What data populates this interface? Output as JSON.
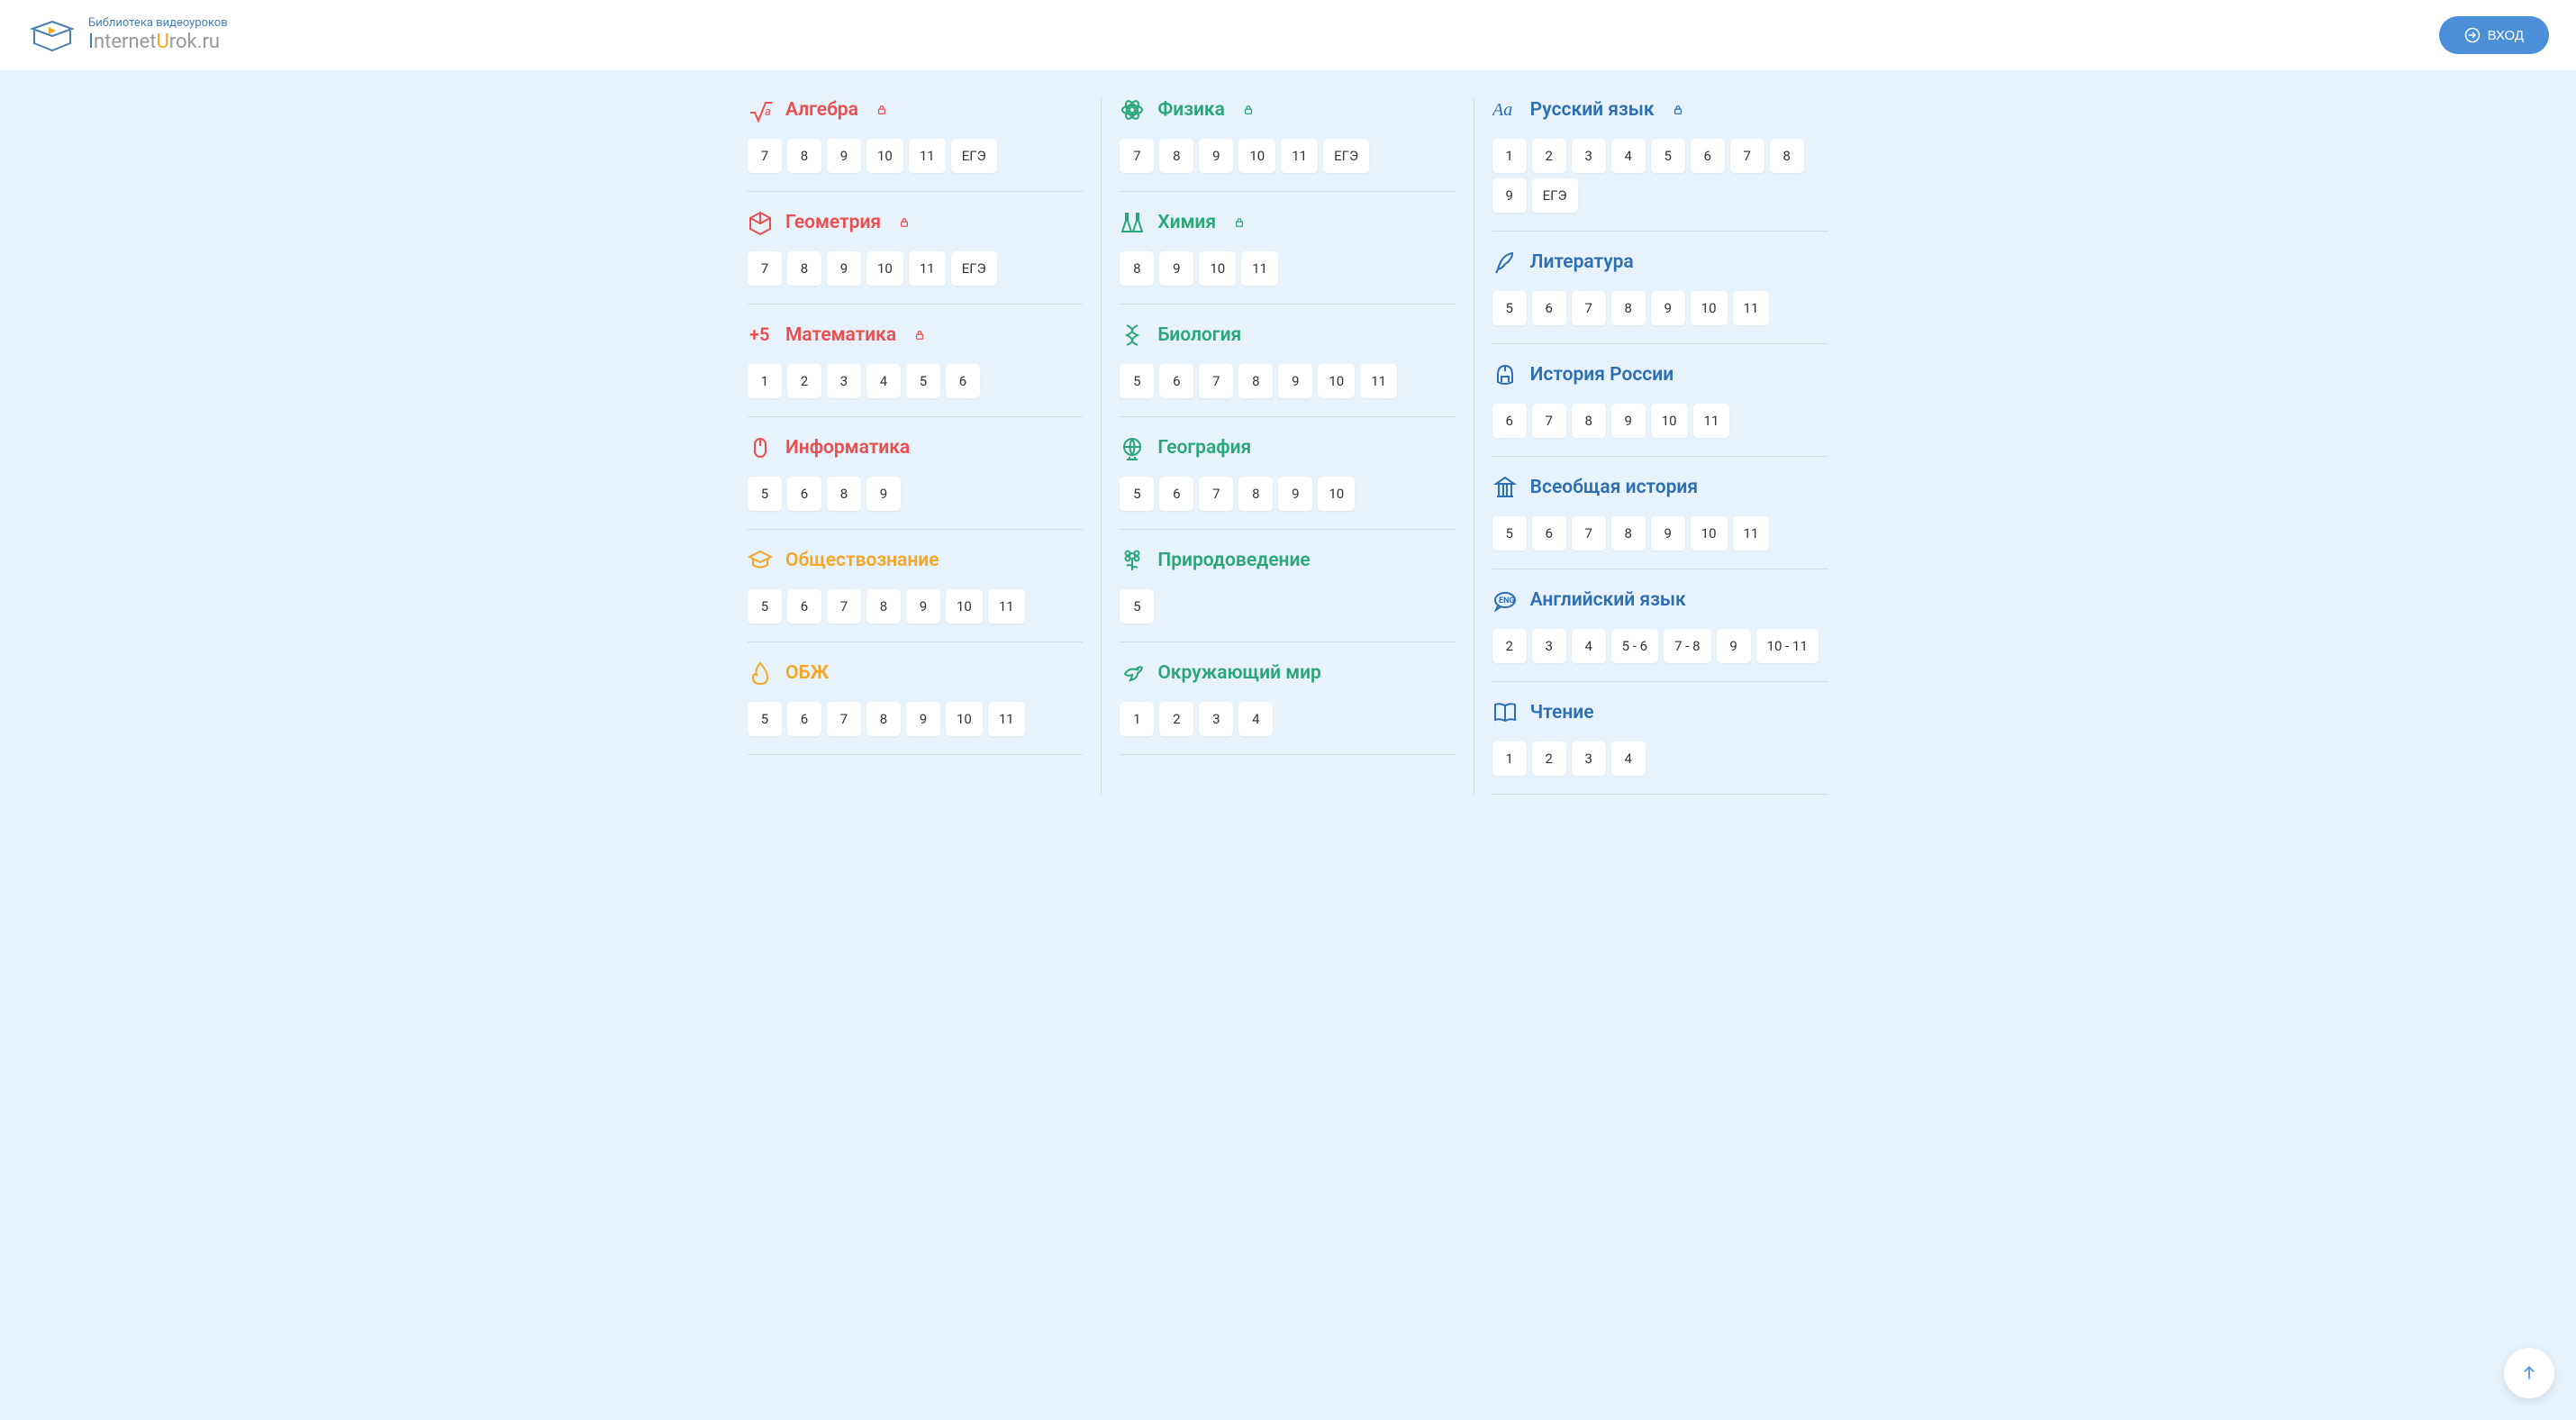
{
  "header": {
    "sub": "Библиотека видеоуроков",
    "brand_i": "I",
    "brand_m1": "nternet",
    "brand_u": "U",
    "brand_m2": "rok.ru",
    "login": "ВХОД"
  },
  "columns": [
    [
      {
        "title": "Алгебра",
        "icon": "sqrt",
        "lock": true,
        "color": "red",
        "grades": [
          "7",
          "8",
          "9",
          "10",
          "11",
          "ЕГЭ"
        ]
      },
      {
        "title": "Геометрия",
        "icon": "cube",
        "lock": true,
        "color": "red",
        "grades": [
          "7",
          "8",
          "9",
          "10",
          "11",
          "ЕГЭ"
        ]
      },
      {
        "title": "Математика",
        "icon": "plus5",
        "lock": true,
        "color": "red",
        "grades": [
          "1",
          "2",
          "3",
          "4",
          "5",
          "6"
        ]
      },
      {
        "title": "Информатика",
        "icon": "mouse",
        "lock": false,
        "color": "red",
        "grades": [
          "5",
          "6",
          "8",
          "9"
        ]
      },
      {
        "title": "Обществознание",
        "icon": "gradcap",
        "lock": false,
        "color": "orange",
        "grades": [
          "5",
          "6",
          "7",
          "8",
          "9",
          "10",
          "11"
        ]
      },
      {
        "title": "ОБЖ",
        "icon": "fire",
        "lock": false,
        "color": "orange",
        "grades": [
          "5",
          "6",
          "7",
          "8",
          "9",
          "10",
          "11"
        ]
      }
    ],
    [
      {
        "title": "Физика",
        "icon": "atom",
        "lock": true,
        "color": "green",
        "grades": [
          "7",
          "8",
          "9",
          "10",
          "11",
          "ЕГЭ"
        ]
      },
      {
        "title": "Химия",
        "icon": "flask",
        "lock": true,
        "color": "green",
        "grades": [
          "8",
          "9",
          "10",
          "11"
        ]
      },
      {
        "title": "Биология",
        "icon": "dna",
        "lock": false,
        "color": "green",
        "grades": [
          "5",
          "6",
          "7",
          "8",
          "9",
          "10",
          "11"
        ]
      },
      {
        "title": "География",
        "icon": "globe",
        "lock": false,
        "color": "green",
        "grades": [
          "5",
          "6",
          "7",
          "8",
          "9",
          "10"
        ]
      },
      {
        "title": "Природоведение",
        "icon": "flower",
        "lock": false,
        "color": "green",
        "grades": [
          "5"
        ]
      },
      {
        "title": "Окружающий мир",
        "icon": "bird",
        "lock": false,
        "color": "green",
        "grades": [
          "1",
          "2",
          "3",
          "4"
        ]
      }
    ],
    [
      {
        "title": "Русский язык",
        "icon": "aa",
        "lock": true,
        "color": "blue",
        "grades": [
          "1",
          "2",
          "3",
          "4",
          "5",
          "6",
          "7",
          "8",
          "9",
          "ЕГЭ"
        ]
      },
      {
        "title": "Литература",
        "icon": "quill",
        "lock": false,
        "color": "blue",
        "grades": [
          "5",
          "6",
          "7",
          "8",
          "9",
          "10",
          "11"
        ]
      },
      {
        "title": "История России",
        "icon": "helmet",
        "lock": false,
        "color": "blue",
        "grades": [
          "6",
          "7",
          "8",
          "9",
          "10",
          "11"
        ]
      },
      {
        "title": "Всеобщая история",
        "icon": "temple",
        "lock": false,
        "color": "blue",
        "grades": [
          "5",
          "6",
          "7",
          "8",
          "9",
          "10",
          "11"
        ]
      },
      {
        "title": "Английский язык",
        "icon": "eng",
        "lock": false,
        "color": "blue",
        "grades": [
          "2",
          "3",
          "4",
          "5 - 6",
          "7 - 8",
          "9",
          "10 - 11"
        ]
      },
      {
        "title": "Чтение",
        "icon": "book",
        "lock": false,
        "color": "blue",
        "grades": [
          "1",
          "2",
          "3",
          "4"
        ]
      }
    ]
  ]
}
